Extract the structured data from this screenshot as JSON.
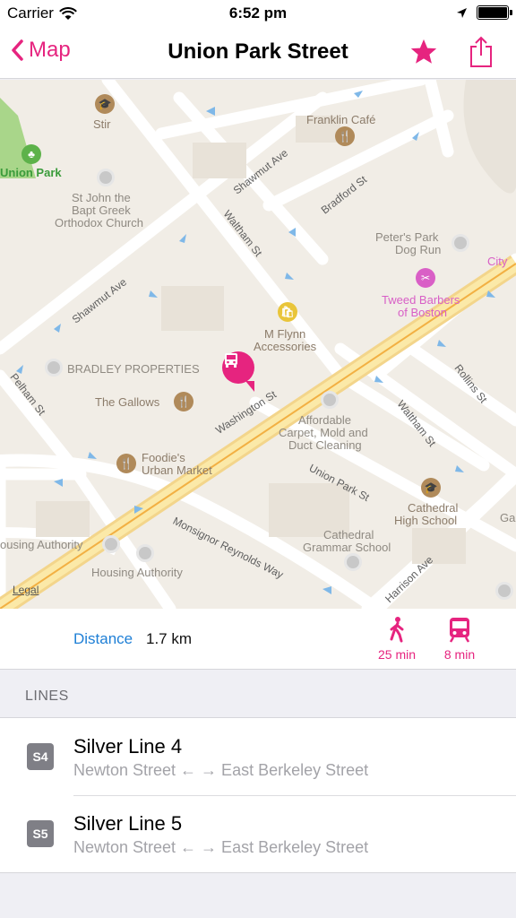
{
  "status_bar": {
    "carrier": "Carrier",
    "time": "6:52 pm",
    "icons": [
      "wifi-icon",
      "location-arrow-icon",
      "battery-icon"
    ]
  },
  "nav": {
    "back_label": "Map",
    "title": "Union Park Street",
    "accent_color": "#e6247f",
    "icons": [
      "chevron-left-icon",
      "star-icon",
      "share-icon"
    ]
  },
  "map": {
    "legal": "Legal",
    "places": {
      "stir": "Stir",
      "franklin_cafe": "Franklin Café",
      "union_park": "Union Park",
      "st_john_1": "St John the",
      "st_john_2": "Bapt Greek",
      "st_john_3": "Orthodox Church",
      "peters_park_1": "Peter's Park",
      "peters_park_2": "Dog Run",
      "city": "City",
      "tweed_1": "Tweed Barbers",
      "tweed_2": "of Boston",
      "m_flynn_1": "M Flynn",
      "m_flynn_2": "Accessories",
      "bradley": "BRADLEY PROPERTIES",
      "gallows": "The Gallows",
      "affordable_1": "Affordable",
      "affordable_2": "Carpet, Mold and",
      "affordable_3": "Duct Cleaning",
      "foodies_1": "Foodie's",
      "foodies_2": "Urban Market",
      "cathedral_hs_1": "Cathedral",
      "cathedral_hs_2": "High School",
      "cathedral_gs_1": "Cathedral",
      "cathedral_gs_2": "Grammar School",
      "housing_1": "ousing Authority",
      "housing_2": "Housing Authority",
      "ga": "Ga"
    },
    "streets": {
      "shawmut_top": "Shawmut Ave",
      "shawmut_left": "Shawmut Ave",
      "bradford": "Bradford St",
      "waltham_top": "Waltham St",
      "waltham_bottom": "Waltham St",
      "pelham": "Pelham St",
      "washington": "Washington St",
      "union_park": "Union Park St",
      "rollins": "Rollins St",
      "msgr_reynolds": "Monsignor Reynolds Way",
      "harrison": "Harrison Ave"
    }
  },
  "info": {
    "distance_label": "Distance",
    "distance_value": "1.7 km",
    "walk_time": "25 min",
    "transit_time": "8 min",
    "icons": [
      "walk-icon",
      "train-icon"
    ]
  },
  "lines_section": {
    "header": "LINES",
    "lines": [
      {
        "badge": "S4",
        "name": "Silver Line 4",
        "route": "Newton Street ← → East Berkeley Street"
      },
      {
        "badge": "S5",
        "name": "Silver Line 5",
        "route": "Newton Street ← → East Berkeley Street"
      }
    ]
  }
}
